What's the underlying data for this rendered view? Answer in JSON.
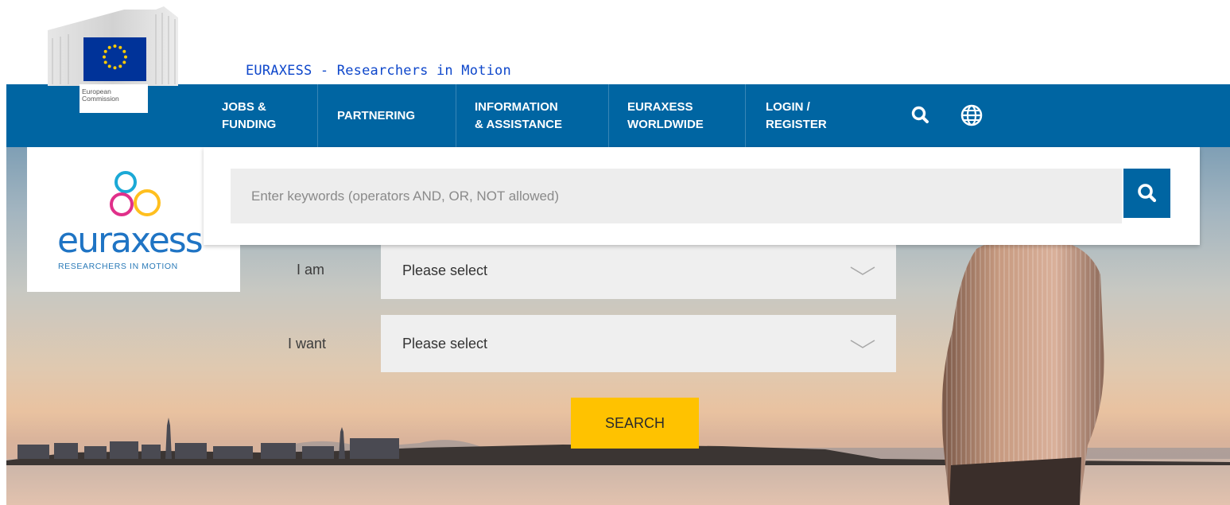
{
  "header": {
    "logo_caption_line1": "European",
    "logo_caption_line2": "Commission",
    "site_title": "EURAXESS - Researchers in Motion"
  },
  "nav": {
    "items": [
      {
        "line1": "JOBS &",
        "line2": "FUNDING"
      },
      {
        "line1": "PARTNERING",
        "line2": ""
      },
      {
        "line1": "INFORMATION",
        "line2": "& ASSISTANCE"
      },
      {
        "line1": "EURAXESS",
        "line2": "WORLDWIDE"
      },
      {
        "line1": "LOGIN /",
        "line2": "REGISTER"
      }
    ],
    "icons": [
      "search-icon",
      "globe-icon"
    ],
    "color": "#0065a2"
  },
  "brand": {
    "logo_text": "euraxess",
    "tagline": "RESEARCHERS IN MOTION"
  },
  "search": {
    "placeholder": "Enter keywords (operators AND, OR, NOT allowed)"
  },
  "form": {
    "i_am_label": "I am",
    "i_am_value": "Please select",
    "i_want_label": "I want",
    "i_want_value": "Please select",
    "submit_label": "SEARCH"
  },
  "colors": {
    "primary": "#0065a2",
    "accent": "#ffc200",
    "title_link": "#0e47cb"
  }
}
